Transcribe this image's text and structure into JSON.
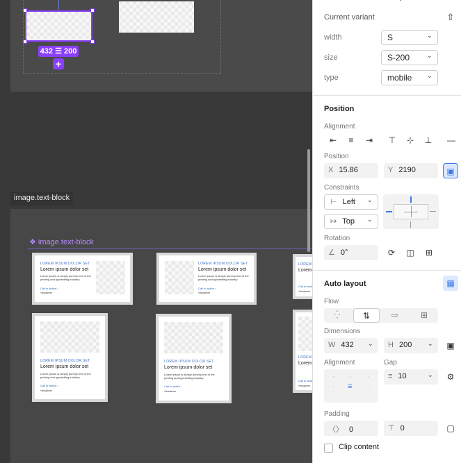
{
  "canvas": {
    "top_badge": "432 ☰ 200",
    "add_glyph": "+",
    "frame_label": "image.text-block",
    "component_label": "❖ image.text-block",
    "card_texts": {
      "eyebrow": "LOREM IPSUM DOLOR SET",
      "heading": "Lorem ipsum dolor set",
      "body": "Lorem Ipsum is simply dummy text of the printing and typesetting industry.",
      "cta": "Call to action ›",
      "disclaimer": "*disclaimer"
    }
  },
  "panel": {
    "variant": {
      "title": "Current variant",
      "rows": [
        {
          "label": "width",
          "value": "S"
        },
        {
          "label": "size",
          "value": "S-200"
        },
        {
          "label": "type",
          "value": "mobile"
        }
      ]
    },
    "position": {
      "title": "Position",
      "alignment_label": "Alignment",
      "position_label": "Position",
      "x_label": "X",
      "x_value": "15.86",
      "y_label": "Y",
      "y_value": "2190",
      "constraints_label": "Constraints",
      "h_constraint": "Left",
      "v_constraint": "Top",
      "rotation_label": "Rotation",
      "rotation_value": "0°"
    },
    "auto_layout": {
      "title": "Auto layout",
      "flow_label": "Flow",
      "dimensions_label": "Dimensions",
      "w_label": "W",
      "w_value": "432",
      "h_label": "H",
      "h_value": "200",
      "alignment_label": "Alignment",
      "gap_label": "Gap",
      "gap_value": "10",
      "padding_label": "Padding",
      "padding_h": "0",
      "padding_v": "0",
      "clip_label": "Clip content"
    }
  },
  "colors": {
    "selection": "#8a3ffc",
    "panel_bg": "#ffffff",
    "canvas": "#3a3a3a",
    "accent_blue": "#3b78e7"
  }
}
